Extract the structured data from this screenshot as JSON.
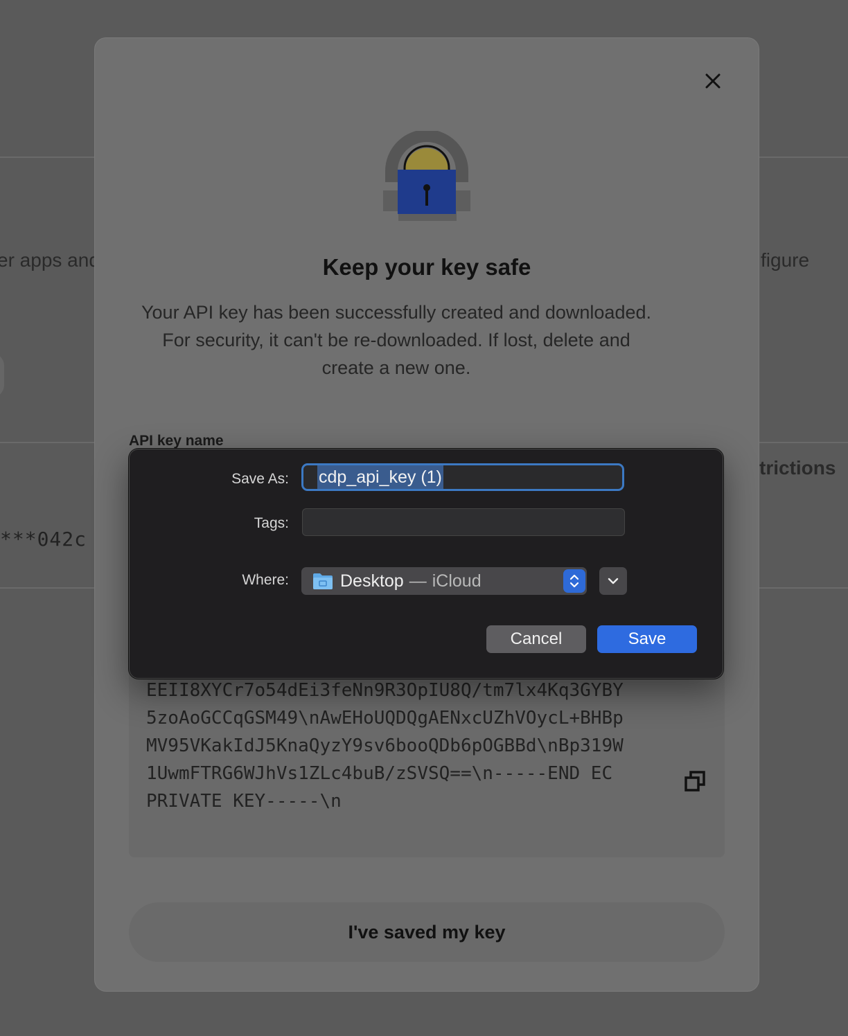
{
  "background": {
    "left_text": "er apps and",
    "right_text": "figure",
    "right_text_2": "trictions",
    "key_suffix": "***042c"
  },
  "modal": {
    "title": "Keep your key safe",
    "description": "Your API key has been successfully created and downloaded. For security, it can't be re-downloaded. If lost, delete and create a new one.",
    "field_label": "API key name",
    "private_key_text": "EEII8XYCr7o54dEi3feNn9R3OpIU8Q/tm7lx4Kq3GYBY5zoAoGCCqGSM49\\nAwEHoUQDQgAENxcUZhVOycL+BHBpMV95VKakIdJ5KnaQyzY9sv6booQDb6pOGBBd\\nBp319W1UwmFTRG6WJhVs1ZLc4buB/zSVSQ==\\n-----END EC PRIVATE KEY-----\\n",
    "confirm_button": "I've saved my key",
    "icons": {
      "close": "close-icon",
      "copy": "copy-icon",
      "lock": "lock-illustration"
    }
  },
  "save_dialog": {
    "save_as_label": "Save As:",
    "save_as_value": "cdp_api_key (1)",
    "tags_label": "Tags:",
    "tags_value": "",
    "where_label": "Where:",
    "where_location": "Desktop",
    "where_separator": "—",
    "where_cloud": "iCloud",
    "cancel_label": "Cancel",
    "save_label": "Save",
    "accent_color": "#2e6be0"
  }
}
